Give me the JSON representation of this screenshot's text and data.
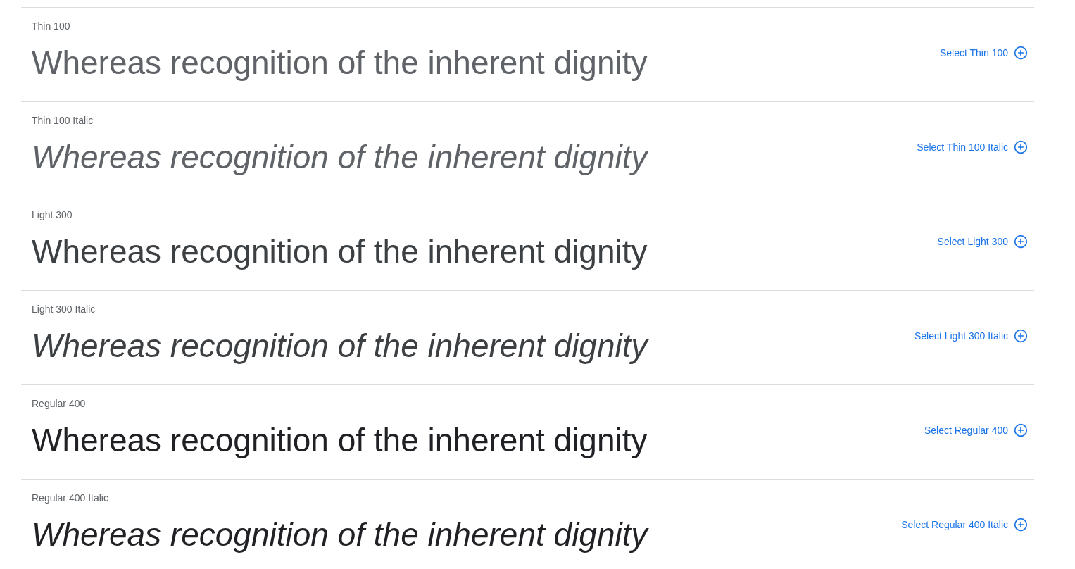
{
  "styles": [
    {
      "label": "Thin 100",
      "kind": "thin",
      "italic": false,
      "sample": "Whereas recognition of the inherent dignity",
      "button": "Select Thin 100"
    },
    {
      "label": "Thin 100 Italic",
      "kind": "thin",
      "italic": true,
      "sample": "Whereas recognition of the inherent dignity",
      "button": "Select Thin 100 Italic"
    },
    {
      "label": "Light 300",
      "kind": "light",
      "italic": false,
      "sample": "Whereas recognition of the inherent dignity",
      "button": "Select Light 300"
    },
    {
      "label": "Light 300 Italic",
      "kind": "light",
      "italic": true,
      "sample": "Whereas recognition of the inherent dignity",
      "button": "Select Light 300 Italic"
    },
    {
      "label": "Regular 400",
      "kind": "regular",
      "italic": false,
      "sample": "Whereas recognition of the inherent dignity",
      "button": "Select Regular 400"
    },
    {
      "label": "Regular 400 Italic",
      "kind": "regular",
      "italic": true,
      "sample": "Whereas recognition of the inherent dignity",
      "button": "Select Regular 400 Italic"
    }
  ]
}
